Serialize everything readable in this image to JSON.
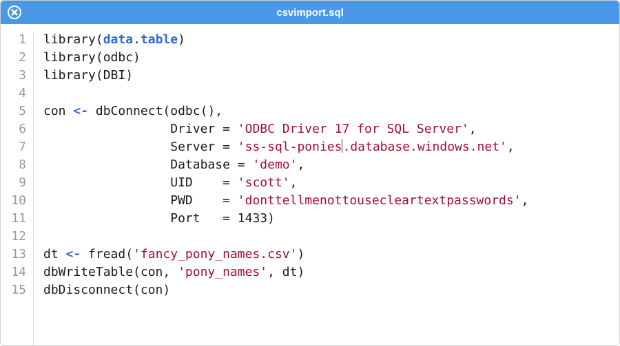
{
  "titlebar": {
    "filename": "csvimport.sql"
  },
  "gutter": {
    "start": 1,
    "end": 15
  },
  "code": {
    "lines": [
      [
        {
          "t": "library(",
          "c": "default"
        },
        {
          "t": "data",
          "c": "keyword"
        },
        {
          "t": ".",
          "c": "default"
        },
        {
          "t": "table",
          "c": "keyword"
        },
        {
          "t": ")",
          "c": "default"
        }
      ],
      [
        {
          "t": "library(odbc)",
          "c": "default"
        }
      ],
      [
        {
          "t": "library(DBI)",
          "c": "default"
        }
      ],
      [
        {
          "t": "",
          "c": "default"
        }
      ],
      [
        {
          "t": "con ",
          "c": "default"
        },
        {
          "t": "<-",
          "c": "assign"
        },
        {
          "t": " dbConnect(odbc(),",
          "c": "default"
        }
      ],
      [
        {
          "t": "                 Driver = ",
          "c": "default"
        },
        {
          "t": "'ODBC Driver 17 for SQL Server'",
          "c": "string"
        },
        {
          "t": ",",
          "c": "default"
        }
      ],
      [
        {
          "t": "                 Server = ",
          "c": "default"
        },
        {
          "t": "'ss-sql-ponies",
          "c": "string"
        },
        {
          "t": "",
          "c": "cursor"
        },
        {
          "t": ".database.windows.net'",
          "c": "string"
        },
        {
          "t": ",",
          "c": "default"
        }
      ],
      [
        {
          "t": "                 Database = ",
          "c": "default"
        },
        {
          "t": "'demo'",
          "c": "string"
        },
        {
          "t": ",",
          "c": "default"
        }
      ],
      [
        {
          "t": "                 UID    = ",
          "c": "default"
        },
        {
          "t": "'scott'",
          "c": "string"
        },
        {
          "t": ",",
          "c": "default"
        }
      ],
      [
        {
          "t": "                 PWD    = ",
          "c": "default"
        },
        {
          "t": "'donttellmenottousecleartextpasswords'",
          "c": "string"
        },
        {
          "t": ",",
          "c": "default"
        }
      ],
      [
        {
          "t": "                 Port   = ",
          "c": "default"
        },
        {
          "t": "1433",
          "c": "number"
        },
        {
          "t": ")",
          "c": "default"
        }
      ],
      [
        {
          "t": "",
          "c": "default"
        }
      ],
      [
        {
          "t": "dt ",
          "c": "default"
        },
        {
          "t": "<-",
          "c": "assign"
        },
        {
          "t": " fread(",
          "c": "default"
        },
        {
          "t": "'fancy_pony_names.csv'",
          "c": "string"
        },
        {
          "t": ")",
          "c": "default"
        }
      ],
      [
        {
          "t": "dbWriteTable(con, ",
          "c": "default"
        },
        {
          "t": "'pony_names'",
          "c": "string"
        },
        {
          "t": ", dt)",
          "c": "default"
        }
      ],
      [
        {
          "t": "dbDisconnect(con)",
          "c": "default"
        }
      ]
    ]
  }
}
